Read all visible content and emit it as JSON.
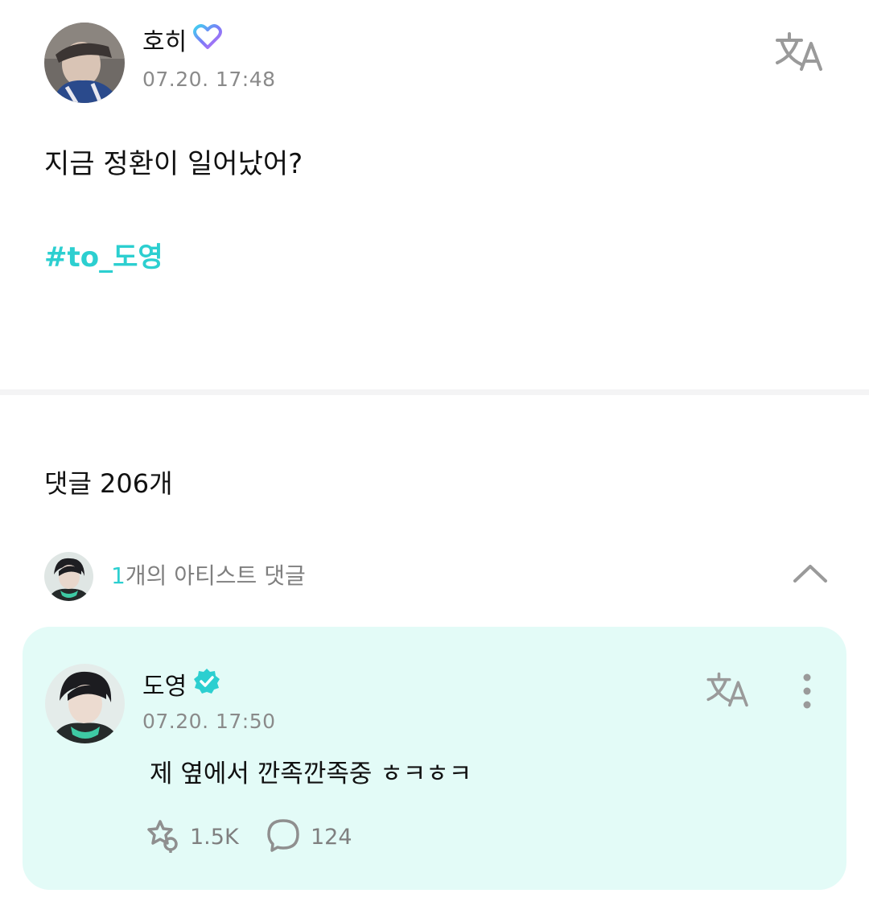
{
  "post": {
    "author": "호히",
    "time": "07.20. 17:48",
    "text": "지금 정환이 일어났어?",
    "hashtag": "#to_도영"
  },
  "comments": {
    "heading": "댓글 206개",
    "artist_summary": {
      "count": "1",
      "label": "개의 아티스트 댓글"
    },
    "artist_comment": {
      "author": "도영",
      "time": "07.20. 17:50",
      "text": "제 옆에서 깐족깐족중 ㅎㅋㅎㅋ",
      "likes": "1.5K",
      "replies": "124"
    }
  },
  "colors": {
    "accent": "#2ccfd0",
    "card_background": "#e3fbf7",
    "secondary_text": "#8a8a8a"
  },
  "icons": [
    "membership-heart-icon",
    "translate-icon",
    "chevron-up-icon",
    "verified-badge-icon",
    "more-vertical-icon",
    "like-icon",
    "comment-icon"
  ]
}
